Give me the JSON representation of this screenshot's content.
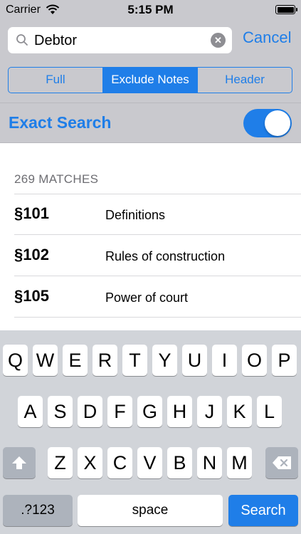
{
  "status_bar": {
    "carrier": "Carrier",
    "time": "5:15 PM"
  },
  "search": {
    "value": "Debtor",
    "cancel_label": "Cancel"
  },
  "segments": [
    {
      "label": "Full",
      "active": false
    },
    {
      "label": "Exclude Notes",
      "active": true
    },
    {
      "label": "Header",
      "active": false
    }
  ],
  "exact_search": {
    "label": "Exact Search",
    "enabled": true
  },
  "results": {
    "count_label": "269 MATCHES",
    "items": [
      {
        "section": "§101",
        "title": "Definitions"
      },
      {
        "section": "§102",
        "title": "Rules of construction"
      },
      {
        "section": "§105",
        "title": "Power of court"
      }
    ]
  },
  "keyboard": {
    "row1": [
      "Q",
      "W",
      "E",
      "R",
      "T",
      "Y",
      "U",
      "I",
      "O",
      "P"
    ],
    "row2": [
      "A",
      "S",
      "D",
      "F",
      "G",
      "H",
      "J",
      "K",
      "L"
    ],
    "row3": [
      "Z",
      "X",
      "C",
      "V",
      "B",
      "N",
      "M"
    ],
    "numbers_label": ".?123",
    "space_label": "space",
    "search_label": "Search"
  },
  "colors": {
    "accent": "#1f7ee8",
    "header_bg": "#c9c9ce",
    "keyboard_bg": "#d1d4d9"
  }
}
